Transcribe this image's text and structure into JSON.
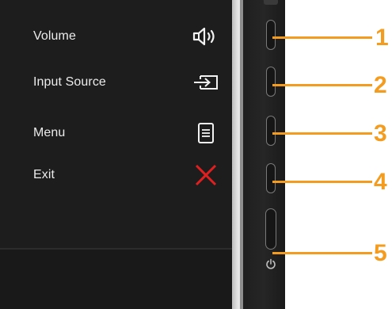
{
  "osd": {
    "items": [
      {
        "label": "Volume",
        "icon": "speaker-volume-icon"
      },
      {
        "label": "Input Source",
        "icon": "input-source-icon"
      },
      {
        "label": "Menu",
        "icon": "menu-document-icon"
      },
      {
        "label": "Exit",
        "icon": "close-x-icon"
      }
    ]
  },
  "callouts": [
    "1",
    "2",
    "3",
    "4",
    "5"
  ],
  "colors": {
    "accent": "#f39c1f",
    "panel_bg": "#1d1d1d",
    "exit_red": "#e02020",
    "label_text": "#ececec"
  }
}
